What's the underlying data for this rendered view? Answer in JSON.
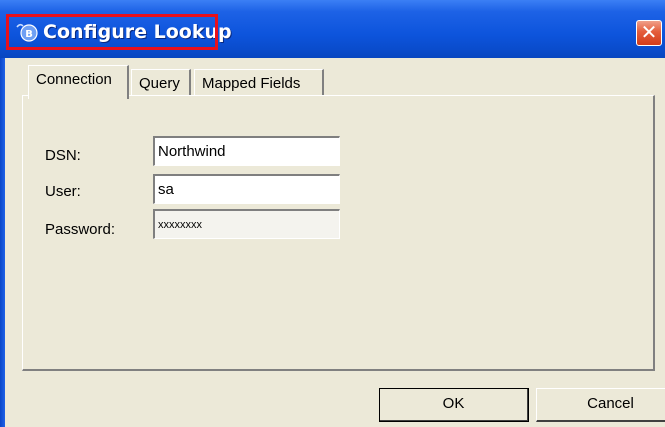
{
  "window": {
    "title": "Configure Lookup",
    "close_glyph": "✕",
    "colors": {
      "titlebar": "#0d54dc",
      "highlight": "#e8101c",
      "close": "#e45d3b",
      "background": "#ece9d8"
    }
  },
  "tabs": [
    {
      "label": "Connection",
      "active": true
    },
    {
      "label": "Query",
      "active": false
    },
    {
      "label": "Mapped Fields",
      "active": false
    }
  ],
  "form": {
    "dsn_label": "DSN:",
    "dsn_value": "Northwind",
    "user_label": "User:",
    "user_value": "sa",
    "password_label": "Password:",
    "password_value": "xxxxxxxx"
  },
  "buttons": {
    "ok": "OK",
    "cancel": "Cancel"
  }
}
